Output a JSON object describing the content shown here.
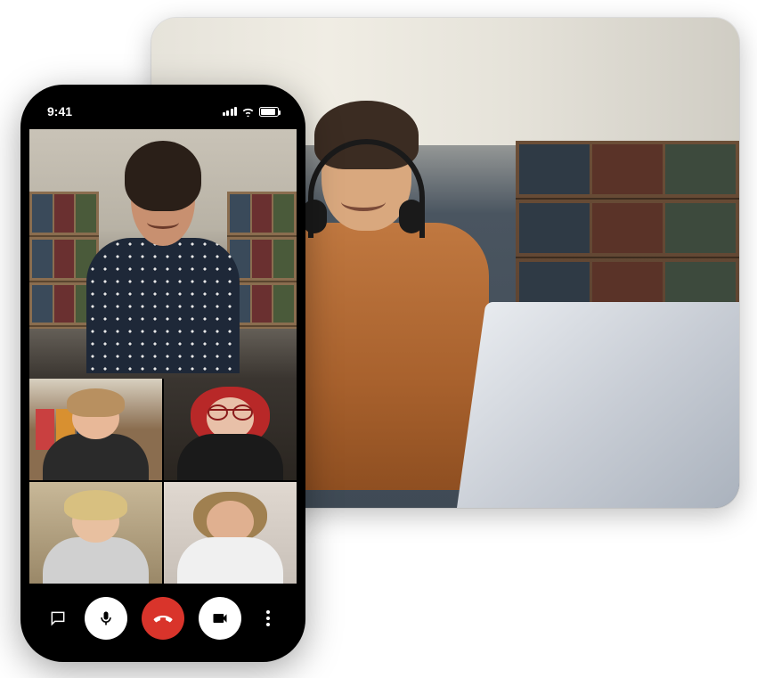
{
  "status_bar": {
    "time": "9:41"
  },
  "call": {
    "main_participant": "participant-1",
    "grid_participants": [
      "participant-2",
      "participant-3",
      "participant-4",
      "participant-5"
    ]
  },
  "controls": {
    "chat": "chat",
    "mic": "microphone",
    "hangup": "end-call",
    "camera": "camera",
    "more": "more-options"
  },
  "colors": {
    "hangup": "#d9342b",
    "button_bg": "#ffffff",
    "phone_body": "#000000"
  }
}
